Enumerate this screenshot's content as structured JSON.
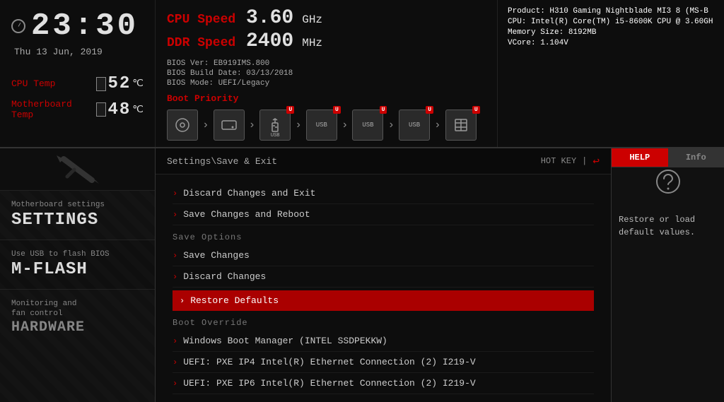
{
  "topbar": {
    "clock": {
      "time": "23:30",
      "date": "Thu  13 Jun, 2019"
    },
    "cpu_temp": {
      "label": "CPU Temp",
      "value": "52",
      "unit": "℃"
    },
    "mb_temp": {
      "label": "Motherboard Temp",
      "value": "48",
      "unit": "℃"
    },
    "cpu_speed": {
      "label": "CPU Speed",
      "value": "3.60",
      "unit": "GHz"
    },
    "ddr_speed": {
      "label": "DDR Speed",
      "value": "2400",
      "unit": "MHz"
    },
    "bios": {
      "ver_label": "BIOS Ver:",
      "ver": "EB919IMS.800",
      "build_label": "BIOS Build Date:",
      "build": "03/13/2018",
      "mode_label": "BIOS Mode:",
      "mode": "UEFI/Legacy",
      "boot_priority": "Boot Priority"
    },
    "product": {
      "product_label": "Product:",
      "product": "H310 Gaming Nightblade MI3 8 (MS-B",
      "cpu_label": "CPU:",
      "cpu": "Intel(R) Core(TM) i5-8600K CPU @ 3.60GH",
      "mem_label": "Memory Size:",
      "mem": "8192MB",
      "vcore_label": "VCore:",
      "vcore": "1.104V"
    }
  },
  "sidebar": {
    "settings_sublabel": "Motherboard settings",
    "settings_title": "SETTINGS",
    "mflash_sublabel": "Use USB to flash BIOS",
    "mflash_title": "M-FLASH",
    "hardware_sublabel": "Monitoring and",
    "hardware_sublabel2": "fan control",
    "hardware_title": "HARDWARE"
  },
  "panel": {
    "path": "Settings\\Save & Exit",
    "hotkey_label": "HOT KEY",
    "separator": "|",
    "back_icon": "↩"
  },
  "menu": {
    "items_top": [
      {
        "label": "Discard Changes and Exit"
      },
      {
        "label": "Save Changes and Reboot"
      }
    ],
    "save_options_label": "Save  Options",
    "items_save": [
      {
        "label": "Save Changes"
      },
      {
        "label": "Discard Changes"
      }
    ],
    "restore_defaults_label": "Restore Defaults",
    "boot_override_label": "Boot  Override",
    "items_boot": [
      {
        "label": "Windows Boot Manager (INTEL SSDPEKKW)"
      },
      {
        "label": "UEFI: PXE IP4 Intel(R) Ethernet Connection (2) I219-V"
      },
      {
        "label": "UEFI: PXE IP6 Intel(R) Ethernet Connection (2) I219-V"
      }
    ]
  },
  "help": {
    "tab1": "HELP",
    "tab2": "Info",
    "content": "Restore or load\ndefault values."
  }
}
